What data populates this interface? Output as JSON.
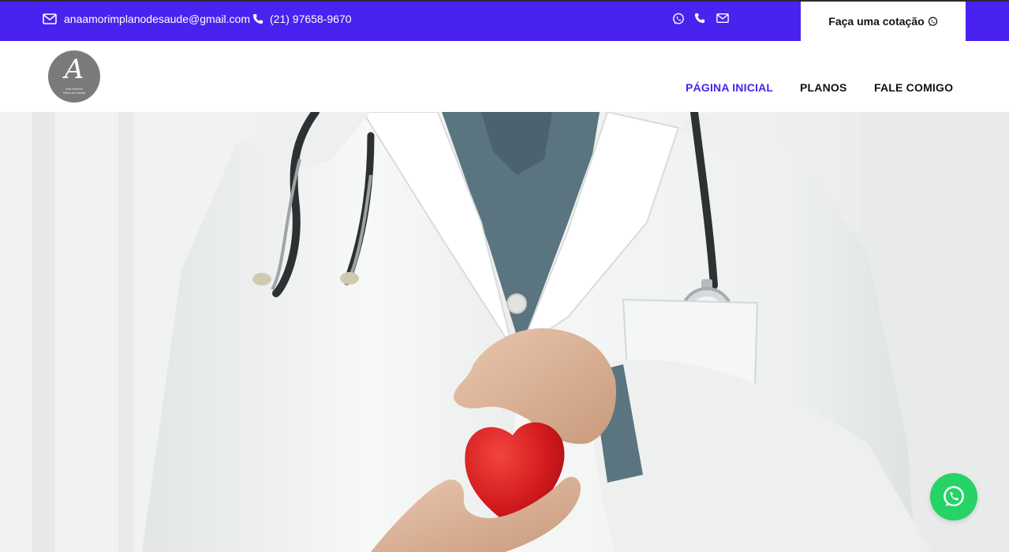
{
  "topbar": {
    "email": "anaamorimplanodesaude@gmail.com",
    "phone": "(21) 97658-9670",
    "social_icons": [
      "whatsapp-icon",
      "phone-icon",
      "envelope-icon"
    ],
    "quote_button_label": "Faça uma cotação",
    "background_color": "#4a22f0"
  },
  "header": {
    "logo": {
      "letter": "A",
      "line1": "Ana Amorim",
      "line2": "Plano de Saúde"
    },
    "nav": [
      {
        "label": "PÁGINA INICIAL",
        "active": true
      },
      {
        "label": "PLANOS",
        "active": false
      },
      {
        "label": "FALE COMIGO",
        "active": false
      }
    ],
    "active_color": "#4a22f0"
  },
  "hero": {
    "image": "doctor-holding-red-heart"
  },
  "floating_button": {
    "icon": "whatsapp-icon",
    "color": "#25d366"
  }
}
